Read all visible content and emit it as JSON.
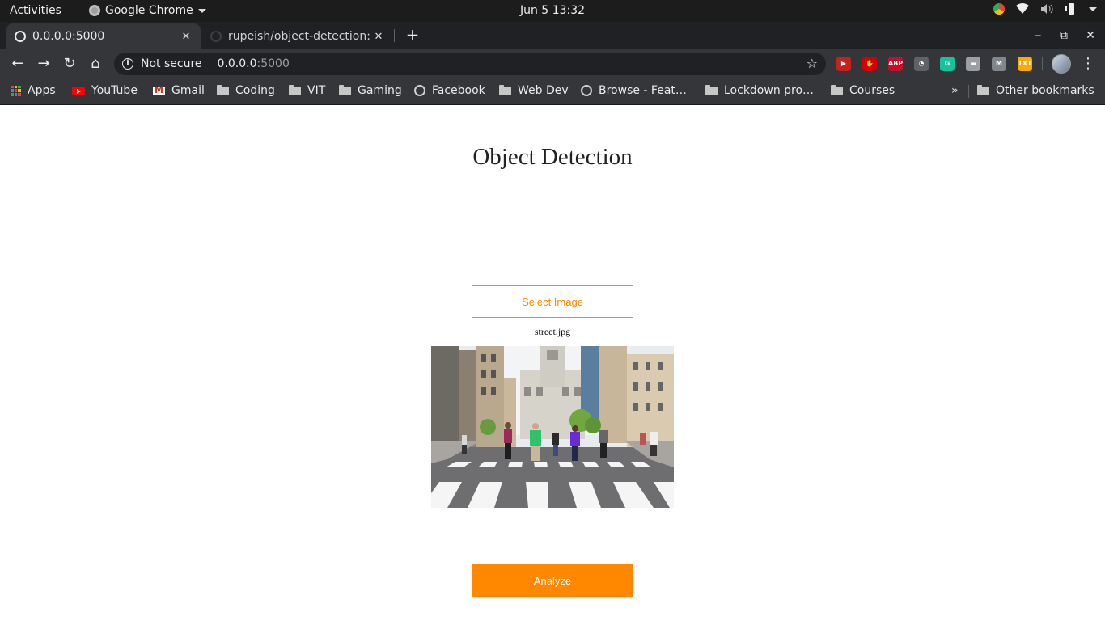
{
  "system_bar": {
    "activities": "Activities",
    "app_name": "Google Chrome",
    "datetime": "Jun 5  13:32"
  },
  "tabs": [
    {
      "title": "0.0.0.0:5000",
      "active": true
    },
    {
      "title": "rupeish/object-detection:",
      "active": false
    }
  ],
  "address_bar": {
    "security_label": "Not secure",
    "host": "0.0.0.0",
    "port": ":5000"
  },
  "bookmarks": [
    {
      "label": "Apps",
      "icon": "apps-grid-icon"
    },
    {
      "label": "YouTube",
      "icon": "youtube-icon"
    },
    {
      "label": "Gmail",
      "icon": "gmail-icon"
    },
    {
      "label": "Coding",
      "icon": "folder-icon"
    },
    {
      "label": "VIT",
      "icon": "folder-icon"
    },
    {
      "label": "Gaming",
      "icon": "folder-icon"
    },
    {
      "label": "Facebook",
      "icon": "globe-icon"
    },
    {
      "label": "Web Dev",
      "icon": "folder-icon"
    },
    {
      "label": "Browse - Feat…",
      "icon": "globe-icon"
    },
    {
      "label": "Lockdown pro…",
      "icon": "folder-icon"
    },
    {
      "label": "Courses",
      "icon": "folder-icon"
    }
  ],
  "bookmarks_overflow": "»",
  "other_bookmarks": "Other bookmarks",
  "extensions": [
    {
      "name": "hoverzoom-icon",
      "color": "#c5221f",
      "text": "▶"
    },
    {
      "name": "adblock-hand-icon",
      "color": "#d50000",
      "text": "✋"
    },
    {
      "name": "abp-icon",
      "color": "#c70d2c",
      "text": "ABP"
    },
    {
      "name": "extension-gauge-icon",
      "color": "#5f6368",
      "text": "◔"
    },
    {
      "name": "grammarly-icon",
      "color": "#15c39a",
      "text": "G"
    },
    {
      "name": "screen-icon",
      "color": "#9aa0a6",
      "text": "▬"
    },
    {
      "name": "m-extension-icon",
      "color": "#80868b",
      "text": "M"
    },
    {
      "name": "text-extension-icon",
      "color": "#f9ab00",
      "text": "TXT"
    }
  ],
  "page": {
    "title": "Object Detection",
    "select_button": "Select Image",
    "filename": "street.jpg",
    "analyze_button": "Analyze"
  },
  "colors": {
    "accent": "#ff8800"
  }
}
